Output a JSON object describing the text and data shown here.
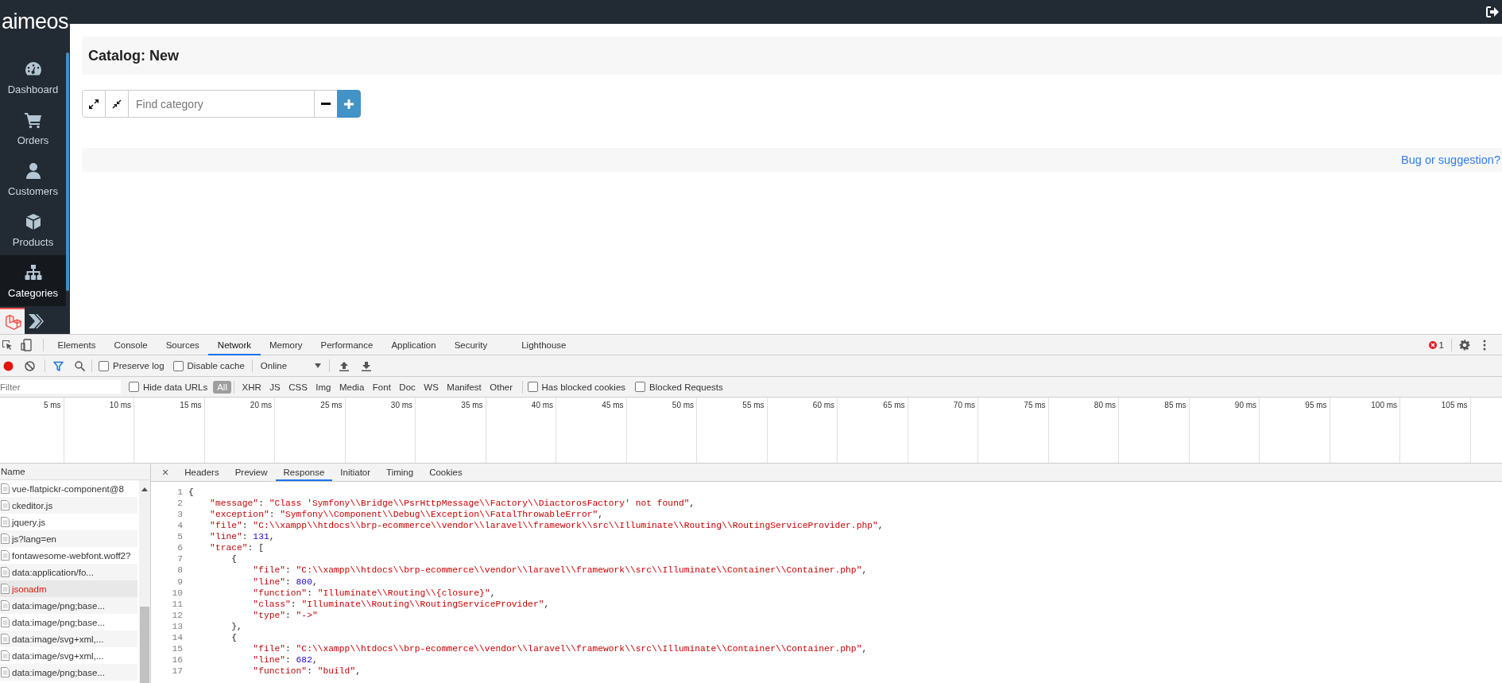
{
  "app": {
    "logo": "aimeos",
    "nav": [
      {
        "label": "Dashboard",
        "selected": false
      },
      {
        "label": "Orders",
        "selected": false
      },
      {
        "label": "Customers",
        "selected": false
      },
      {
        "label": "Products",
        "selected": false
      },
      {
        "label": "Categories",
        "selected": true
      }
    ],
    "page_title": "Catalog: New",
    "search": {
      "placeholder": "Find category"
    },
    "footer_link": "Bug or suggestion?"
  },
  "devtools": {
    "tabs": [
      {
        "label": "Elements",
        "selected": false
      },
      {
        "label": "Console",
        "selected": false
      },
      {
        "label": "Sources",
        "selected": false
      },
      {
        "label": "Network",
        "selected": true
      },
      {
        "label": "Memory",
        "selected": false
      },
      {
        "label": "Performance",
        "selected": false
      },
      {
        "label": "Application",
        "selected": false
      },
      {
        "label": "Security",
        "selected": false
      },
      {
        "label": "Lighthouse",
        "selected": false
      }
    ],
    "error_count": "1",
    "toolbar": {
      "preserve_log": {
        "label": "Preserve log",
        "checked": false
      },
      "disable_cache": {
        "label": "Disable cache",
        "checked": false
      },
      "throttling": "Online"
    },
    "filter": {
      "placeholder": "Filter",
      "hide_data_urls": {
        "label": "Hide data URLs",
        "checked": false
      },
      "types": [
        {
          "label": "All",
          "selected": true
        },
        {
          "label": "XHR",
          "selected": false
        },
        {
          "label": "JS",
          "selected": false
        },
        {
          "label": "CSS",
          "selected": false
        },
        {
          "label": "Img",
          "selected": false
        },
        {
          "label": "Media",
          "selected": false
        },
        {
          "label": "Font",
          "selected": false
        },
        {
          "label": "Doc",
          "selected": false
        },
        {
          "label": "WS",
          "selected": false
        },
        {
          "label": "Manifest",
          "selected": false
        },
        {
          "label": "Other",
          "selected": false
        }
      ],
      "has_blocked_cookies": {
        "label": "Has blocked cookies",
        "checked": false
      },
      "blocked_requests": {
        "label": "Blocked Requests",
        "checked": false
      }
    },
    "timeline_ticks": [
      "5 ms",
      "10 ms",
      "15 ms",
      "20 ms",
      "25 ms",
      "30 ms",
      "35 ms",
      "40 ms",
      "45 ms",
      "50 ms",
      "55 ms",
      "60 ms",
      "65 ms",
      "70 ms",
      "75 ms",
      "80 ms",
      "85 ms",
      "90 ms",
      "95 ms",
      "100 ms",
      "105 ms"
    ],
    "requests": {
      "header": "Name",
      "rows": [
        {
          "name": "vue-flatpickr-component@8",
          "selected": false,
          "error": false
        },
        {
          "name": "ckeditor.js",
          "selected": false,
          "error": false
        },
        {
          "name": "jquery.js",
          "selected": false,
          "error": false
        },
        {
          "name": "js?lang=en",
          "selected": false,
          "error": false
        },
        {
          "name": "fontawesome-webfont.woff2?",
          "selected": false,
          "error": false
        },
        {
          "name": "data:application/fo...",
          "selected": false,
          "error": false
        },
        {
          "name": "jsonadm",
          "selected": true,
          "error": true
        },
        {
          "name": "data:image/png;base...",
          "selected": false,
          "error": false
        },
        {
          "name": "data:image/png;base...",
          "selected": false,
          "error": false
        },
        {
          "name": "data:image/svg+xml,...",
          "selected": false,
          "error": false
        },
        {
          "name": "data:image/svg+xml,...",
          "selected": false,
          "error": false
        },
        {
          "name": "data:image/png;base...",
          "selected": false,
          "error": false
        }
      ]
    },
    "detail": {
      "close": "×",
      "tabs": [
        {
          "label": "Headers",
          "selected": false
        },
        {
          "label": "Preview",
          "selected": false
        },
        {
          "label": "Response",
          "selected": true
        },
        {
          "label": "Initiator",
          "selected": false
        },
        {
          "label": "Timing",
          "selected": false
        },
        {
          "label": "Cookies",
          "selected": false
        }
      ],
      "lines": [
        {
          "number": "1",
          "tokens": [
            {
              "kind": "punct",
              "text": "{"
            }
          ]
        },
        {
          "number": "2",
          "tokens": [
            {
              "kind": "key",
              "text": "    \"message\""
            },
            {
              "kind": "punct",
              "text": ": "
            },
            {
              "kind": "string",
              "text": "\"Class 'Symfony\\\\Bridge\\\\PsrHttpMessage\\\\Factory\\\\DiactorosFactory' not found\""
            },
            {
              "kind": "punct",
              "text": ","
            }
          ]
        },
        {
          "number": "3",
          "tokens": [
            {
              "kind": "key",
              "text": "    \"exception\""
            },
            {
              "kind": "punct",
              "text": ": "
            },
            {
              "kind": "string",
              "text": "\"Symfony\\\\Component\\\\Debug\\\\Exception\\\\FatalThrowableError\""
            },
            {
              "kind": "punct",
              "text": ","
            }
          ]
        },
        {
          "number": "4",
          "tokens": [
            {
              "kind": "key",
              "text": "    \"file\""
            },
            {
              "kind": "punct",
              "text": ": "
            },
            {
              "kind": "string",
              "text": "\"C:\\\\xampp\\\\htdocs\\\\brp-ecommerce\\\\vendor\\\\laravel\\\\framework\\\\src\\\\Illuminate\\\\Routing\\\\RoutingServiceProvider.php\""
            },
            {
              "kind": "punct",
              "text": ","
            }
          ]
        },
        {
          "number": "5",
          "tokens": [
            {
              "kind": "key",
              "text": "    \"line\""
            },
            {
              "kind": "punct",
              "text": ": "
            },
            {
              "kind": "number",
              "text": "131"
            },
            {
              "kind": "punct",
              "text": ","
            }
          ]
        },
        {
          "number": "6",
          "tokens": [
            {
              "kind": "key",
              "text": "    \"trace\""
            },
            {
              "kind": "punct",
              "text": ": ["
            }
          ]
        },
        {
          "number": "7",
          "tokens": [
            {
              "kind": "punct",
              "text": "        {"
            }
          ]
        },
        {
          "number": "8",
          "tokens": [
            {
              "kind": "key",
              "text": "            \"file\""
            },
            {
              "kind": "punct",
              "text": ": "
            },
            {
              "kind": "string",
              "text": "\"C:\\\\xampp\\\\htdocs\\\\brp-ecommerce\\\\vendor\\\\laravel\\\\framework\\\\src\\\\Illuminate\\\\Container\\\\Container.php\""
            },
            {
              "kind": "punct",
              "text": ","
            }
          ]
        },
        {
          "number": "9",
          "tokens": [
            {
              "kind": "key",
              "text": "            \"line\""
            },
            {
              "kind": "punct",
              "text": ": "
            },
            {
              "kind": "number",
              "text": "800"
            },
            {
              "kind": "punct",
              "text": ","
            }
          ]
        },
        {
          "number": "10",
          "tokens": [
            {
              "kind": "key",
              "text": "            \"function\""
            },
            {
              "kind": "punct",
              "text": ": "
            },
            {
              "kind": "string",
              "text": "\"Illuminate\\\\Routing\\\\{closure}\""
            },
            {
              "kind": "punct",
              "text": ","
            }
          ]
        },
        {
          "number": "11",
          "tokens": [
            {
              "kind": "key",
              "text": "            \"class\""
            },
            {
              "kind": "punct",
              "text": ": "
            },
            {
              "kind": "string",
              "text": "\"Illuminate\\\\Routing\\\\RoutingServiceProvider\""
            },
            {
              "kind": "punct",
              "text": ","
            }
          ]
        },
        {
          "number": "12",
          "tokens": [
            {
              "kind": "key",
              "text": "            \"type\""
            },
            {
              "kind": "punct",
              "text": ": "
            },
            {
              "kind": "string",
              "text": "\"->\""
            }
          ]
        },
        {
          "number": "13",
          "tokens": [
            {
              "kind": "punct",
              "text": "        },"
            }
          ]
        },
        {
          "number": "14",
          "tokens": [
            {
              "kind": "punct",
              "text": "        {"
            }
          ]
        },
        {
          "number": "15",
          "tokens": [
            {
              "kind": "key",
              "text": "            \"file\""
            },
            {
              "kind": "punct",
              "text": ": "
            },
            {
              "kind": "string",
              "text": "\"C:\\\\xampp\\\\htdocs\\\\brp-ecommerce\\\\vendor\\\\laravel\\\\framework\\\\src\\\\Illuminate\\\\Container\\\\Container.php\""
            },
            {
              "kind": "punct",
              "text": ","
            }
          ]
        },
        {
          "number": "16",
          "tokens": [
            {
              "kind": "key",
              "text": "            \"line\""
            },
            {
              "kind": "punct",
              "text": ": "
            },
            {
              "kind": "number",
              "text": "682"
            },
            {
              "kind": "punct",
              "text": ","
            }
          ]
        },
        {
          "number": "17",
          "tokens": [
            {
              "kind": "key",
              "text": "            \"function\""
            },
            {
              "kind": "punct",
              "text": ": "
            },
            {
              "kind": "string",
              "text": "\"build\""
            },
            {
              "kind": "punct",
              "text": ","
            }
          ]
        }
      ]
    }
  }
}
